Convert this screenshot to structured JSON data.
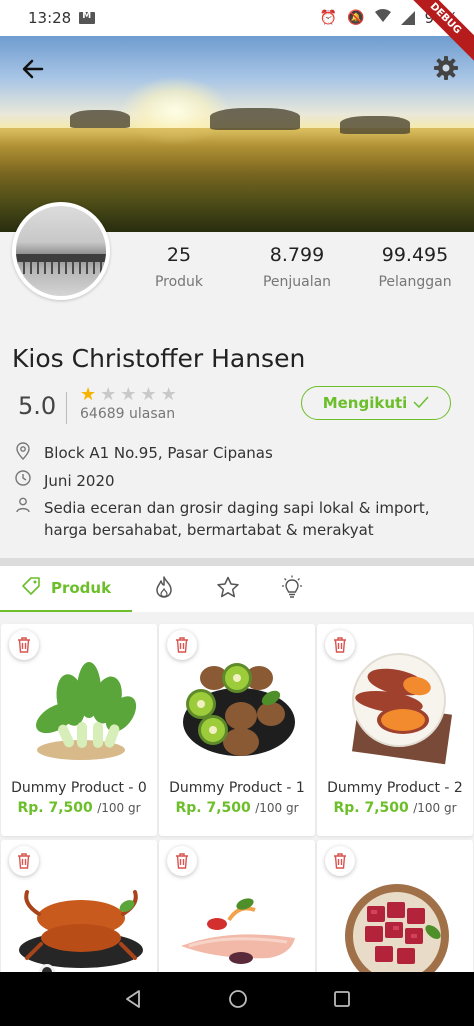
{
  "status_bar": {
    "time": "13:28",
    "battery": "94%",
    "debug_label": "DEBUG"
  },
  "header": {
    "back_icon": "arrow-left-icon",
    "settings_icon": "gear-icon"
  },
  "stats": [
    {
      "value": "25",
      "label": "Produk"
    },
    {
      "value": "8.799",
      "label": "Penjualan"
    },
    {
      "value": "99.495",
      "label": "Pelanggan"
    }
  ],
  "store": {
    "name": "Kios Christoffer Hansen",
    "rating": "5.0",
    "stars_filled": 1,
    "stars_total": 5,
    "review_count": "64689 ulasan",
    "follow_label": "Mengikuti",
    "address": "Block A1 No.95, Pasar Cipanas",
    "joined": "Juni 2020",
    "description": "Sedia eceran dan grosir daging sapi lokal & import, harga bersahabat, bermartabat & merakyat"
  },
  "tabs": [
    {
      "label": "Produk",
      "icon": "tag-icon",
      "active": true
    },
    {
      "label": "",
      "icon": "fire-icon",
      "active": false
    },
    {
      "label": "",
      "icon": "star-icon",
      "active": false
    },
    {
      "label": "",
      "icon": "lightbulb-icon",
      "active": false
    }
  ],
  "products": [
    {
      "name": "Dummy Product - 0",
      "price": "Rp. 7,500",
      "unit": "/100 gr",
      "image": "bok-choy"
    },
    {
      "name": "Dummy Product - 1",
      "price": "Rp. 7,500",
      "unit": "/100 gr",
      "image": "kiwi"
    },
    {
      "name": "Dummy Product - 2",
      "price": "Rp. 7,500",
      "unit": "/100 gr",
      "image": "sweet-potato"
    },
    {
      "name": "",
      "price": "",
      "unit": "",
      "image": "crab"
    },
    {
      "name": "",
      "price": "",
      "unit": "",
      "image": "fish-fillet"
    },
    {
      "name": "",
      "price": "",
      "unit": "",
      "image": "beef-cubes"
    }
  ],
  "colors": {
    "accent": "#6cbf2a",
    "star": "#f6b400",
    "delete": "#d9534f"
  }
}
